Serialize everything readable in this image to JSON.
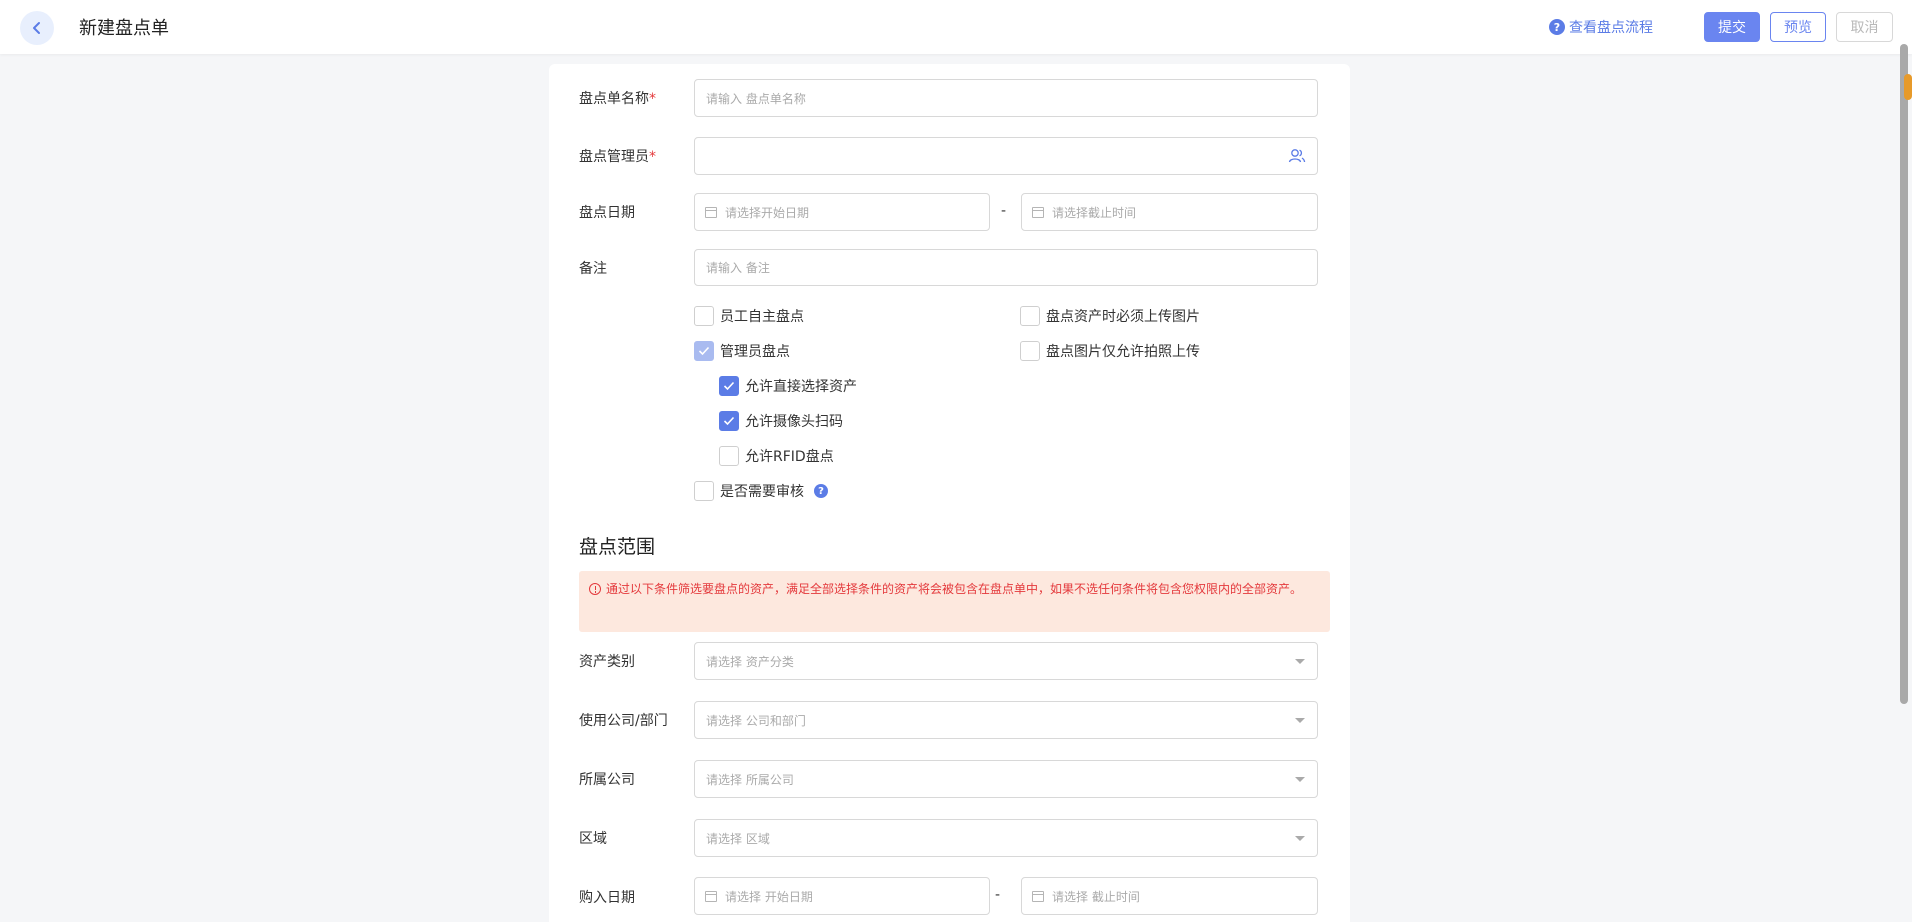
{
  "header": {
    "title": "新建盘点单",
    "flow_link": "查看盘点流程",
    "submit": "提交",
    "preview": "预览",
    "cancel": "取消"
  },
  "form": {
    "name": {
      "label": "盘点单名称",
      "required": "*",
      "placeholder": "请输入 盘点单名称"
    },
    "manager": {
      "label": "盘点管理员",
      "required": "*"
    },
    "date": {
      "label": "盘点日期",
      "start_placeholder": "请选择开始日期",
      "sep": "-",
      "end_placeholder": "请选择截止时间"
    },
    "remark": {
      "label": "备注",
      "placeholder": "请输入 备注"
    },
    "options": {
      "self_check": {
        "label": "员工自主盘点",
        "checked": false
      },
      "must_upload": {
        "label": "盘点资产时必须上传图片",
        "checked": false
      },
      "admin_check": {
        "label": "管理员盘点",
        "checked": true
      },
      "photo_only": {
        "label": "盘点图片仅允许拍照上传",
        "checked": false
      },
      "direct_select": {
        "label": "允许直接选择资产",
        "checked": true
      },
      "camera_scan": {
        "label": "允许摄像头扫码",
        "checked": true
      },
      "rfid": {
        "label": "允许RFID盘点",
        "checked": false
      },
      "need_review": {
        "label": "是否需要审核",
        "checked": false
      }
    }
  },
  "scope": {
    "title": "盘点范围",
    "notice": "通过以下条件筛选要盘点的资产，满足全部选择条件的资产将会被包含在盘点单中，如果不选任何条件将包含您权限内的全部资产。",
    "category": {
      "label": "资产类别",
      "placeholder": "请选择 资产分类"
    },
    "dept": {
      "label": "使用公司/部门",
      "placeholder": "请选择 公司和部门"
    },
    "company": {
      "label": "所属公司",
      "placeholder": "请选择 所属公司"
    },
    "area": {
      "label": "区域",
      "placeholder": "请选择 区域"
    },
    "purchase": {
      "label": "购入日期",
      "start_placeholder": "请选择 开始日期",
      "sep": "-",
      "end_placeholder": "请选择 截止时间"
    }
  },
  "colors": {
    "primary": "#5b7ce6",
    "notice_bg": "#fde8de",
    "danger": "#e4393c"
  }
}
